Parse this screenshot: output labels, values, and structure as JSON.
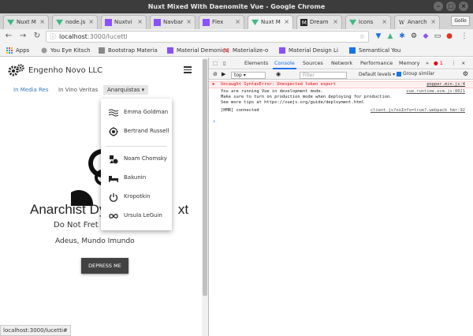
{
  "window": {
    "title": "Nuxt Mixed With Daenomite Vue - Google Chrome"
  },
  "tabs": [
    {
      "label": "Nuxt M",
      "color": "#41b883"
    },
    {
      "label": "node.js",
      "color": "#41b883"
    },
    {
      "label": "Nuxtvi",
      "color": "#8a4fff"
    },
    {
      "label": "Navbar",
      "color": "#8a4fff"
    },
    {
      "label": "Flex",
      "color": "#8a4fff"
    },
    {
      "label": "Nuxt M",
      "color": "#41b883"
    },
    {
      "label": "Dream",
      "color": "#222222"
    },
    {
      "label": "Icons",
      "color": "#41b883"
    },
    {
      "label": "Anarch",
      "color": "#444444"
    }
  ],
  "profile": {
    "label": "Gollo"
  },
  "address": {
    "host": "localhost",
    "path": ":3000/lucetti"
  },
  "bookmarks": [
    {
      "label": "Apps",
      "color": "#4285f4"
    },
    {
      "label": "You Eye Kitsch",
      "color": "#999999"
    },
    {
      "label": "Bootstrap Materia",
      "color": "#888888"
    },
    {
      "label": "Material Demonics",
      "color": "#8a4fff"
    },
    {
      "label": "Materialize-o",
      "color": "#ee6e73"
    },
    {
      "label": "Material Design Li",
      "color": "#8a4fff"
    },
    {
      "label": "Semantical You",
      "color": "#1a73e8"
    }
  ],
  "site": {
    "brand": "Engenho Novo LLC",
    "nav": [
      "In Media Res",
      "In Vino Veritas",
      "Anarquistas"
    ],
    "hero_title": "Anarchist Dyn",
    "hero_title_tail": "xt",
    "hero_sub": "Do Not Fret",
    "hero_sub2": "Adeus, Mundo Imundo",
    "button": "DEPRESS ME",
    "dropdown": [
      {
        "label": "Emma Goldman",
        "icon": "waves-icon"
      },
      {
        "label": "Bertrand Russell",
        "icon": "target-icon"
      },
      {
        "label": "Noam Chomsky",
        "icon": "shapes-icon"
      },
      {
        "label": "Bakunin",
        "icon": "bed-icon"
      },
      {
        "label": "Kropotkin",
        "icon": "power-icon"
      },
      {
        "label": "Ursula LeGuin",
        "icon": "infinity-icon"
      }
    ]
  },
  "status_url": "localhost:3000/lucetti#",
  "devtools": {
    "tabs": [
      "Elements",
      "Console",
      "Sources",
      "Network",
      "Performance",
      "Memory"
    ],
    "active_tab": "Console",
    "more": "»",
    "errors": "1",
    "context": "top",
    "filter_placeholder": "Filter",
    "levels": "Default levels ▾",
    "group_similar": "Group similar",
    "console": [
      {
        "type": "error",
        "text": "Uncaught SyntaxError: Unexpected token export",
        "src": "popper.min.js:4"
      },
      {
        "type": "info",
        "text": "You are running Vue in development mode.",
        "src": "vue.runtime.esm.js:8021"
      },
      {
        "type": "info",
        "text": "Make sure to turn on production mode when deploying for production.",
        "src": ""
      },
      {
        "type": "info",
        "text": "See more tips at https://vuejs.org/guide/deployment.html",
        "src": ""
      },
      {
        "type": "info",
        "text": "[HMR] connected",
        "src": "client.js?noInfo=true?.webpack_hmr:92"
      }
    ],
    "prompt": "›"
  }
}
